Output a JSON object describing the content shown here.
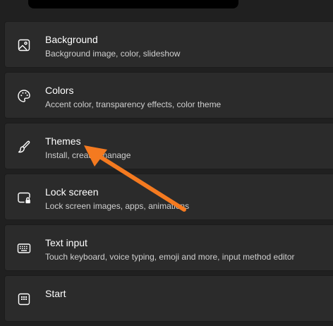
{
  "settings": {
    "items": [
      {
        "title": "Background",
        "description": "Background image, color, slideshow",
        "icon": "image-icon"
      },
      {
        "title": "Colors",
        "description": "Accent color, transparency effects, color theme",
        "icon": "palette-icon"
      },
      {
        "title": "Themes",
        "description": "Install, create, manage",
        "icon": "brush-icon"
      },
      {
        "title": "Lock screen",
        "description": "Lock screen images, apps, animations",
        "icon": "lock-screen-icon"
      },
      {
        "title": "Text input",
        "description": "Touch keyboard, voice typing, emoji and more, input method editor",
        "icon": "keyboard-icon"
      },
      {
        "title": "Start",
        "description": "",
        "icon": "start-menu-icon"
      }
    ]
  },
  "colors": {
    "background": "#202020",
    "card": "#2b2b2b",
    "annotation_arrow": "#f47a20"
  }
}
